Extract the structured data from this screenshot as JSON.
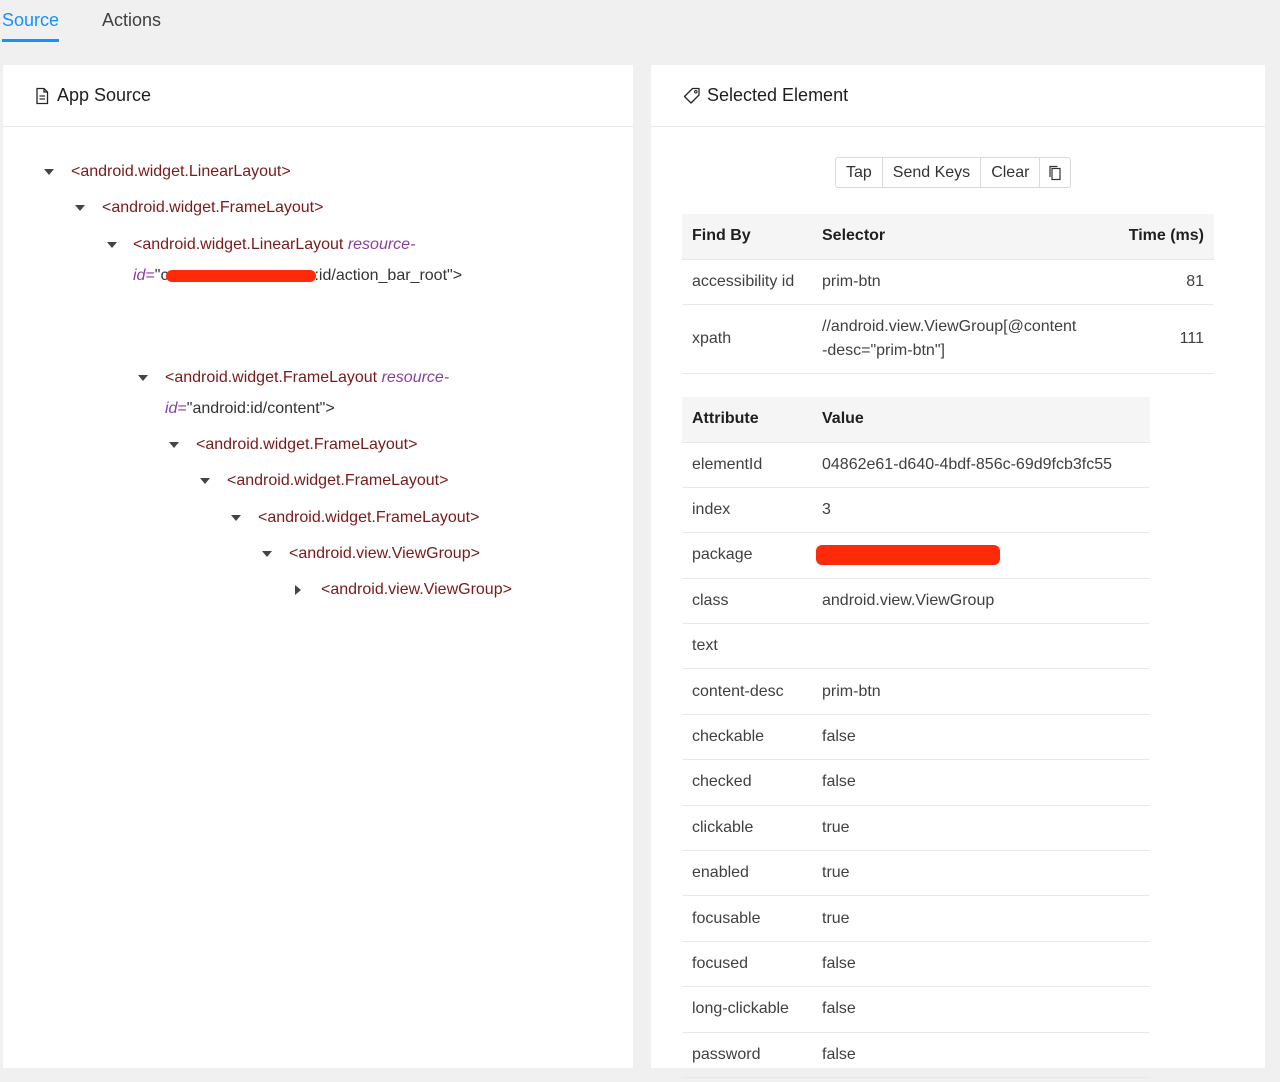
{
  "tabs": [
    {
      "label": "Source",
      "active": true
    },
    {
      "label": "Actions",
      "active": false
    }
  ],
  "colors": {
    "accent": "#1890ff",
    "tag": "#7a1a1a",
    "attr": "#8a3fa0",
    "redaction": "#ff2a0a"
  },
  "left_panel": {
    "title": "App Source",
    "icon": "file-icon",
    "tree": [
      {
        "text": "<android.widget.LinearLayout>",
        "expanded": true
      },
      {
        "text": "<android.widget.FrameLayout>",
        "expanded": true
      },
      {
        "tag": "<android.widget.LinearLayout",
        "attr": "resource-",
        "attr2": "id",
        "eq": "=",
        "val_pre": "\"c",
        "val_post": ":id/action_bar_root\">",
        "redacted": true,
        "expanded": true
      },
      {
        "tag": "<android.widget.FrameLayout",
        "attr": "resource-",
        "attr2": "id",
        "eq": "=",
        "val": "\"android:id/content\">",
        "expanded": true
      },
      {
        "text": "<android.widget.FrameLayout>",
        "expanded": true
      },
      {
        "text": "<android.widget.FrameLayout>",
        "expanded": true
      },
      {
        "text": "<android.widget.FrameLayout>",
        "expanded": true
      },
      {
        "text": "<android.view.ViewGroup>",
        "expanded": true
      },
      {
        "text": "<android.view.ViewGroup>",
        "expanded": false
      }
    ]
  },
  "right_panel": {
    "title": "Selected Element",
    "icon": "tag-icon",
    "buttons": {
      "tap": "Tap",
      "send_keys": "Send Keys",
      "clear": "Clear",
      "copy_icon": "copy-icon"
    },
    "find_by": {
      "headers": [
        "Find By",
        "Selector",
        "Time (ms)"
      ],
      "rows": [
        {
          "find_by": "accessibility id",
          "selector": "prim-btn",
          "time": "81"
        },
        {
          "find_by": "xpath",
          "selector_l1": "//android.view.ViewGroup[@content",
          "selector_l2": "-desc=\"prim-btn\"]",
          "time": "111"
        }
      ]
    },
    "attributes": {
      "headers": [
        "Attribute",
        "Value"
      ],
      "rows": [
        {
          "name": "elementId",
          "value": "04862e61-d640-4bdf-856c-69d9fcb3fc55"
        },
        {
          "name": "index",
          "value": "3"
        },
        {
          "name": "package",
          "value": "",
          "redacted": true
        },
        {
          "name": "class",
          "value": "android.view.ViewGroup"
        },
        {
          "name": "text",
          "value": ""
        },
        {
          "name": "content-desc",
          "value": "prim-btn"
        },
        {
          "name": "checkable",
          "value": "false"
        },
        {
          "name": "checked",
          "value": "false"
        },
        {
          "name": "clickable",
          "value": "true"
        },
        {
          "name": "enabled",
          "value": "true"
        },
        {
          "name": "focusable",
          "value": "true"
        },
        {
          "name": "focused",
          "value": "false"
        },
        {
          "name": "long-clickable",
          "value": "false"
        },
        {
          "name": "password",
          "value": "false"
        }
      ]
    }
  }
}
